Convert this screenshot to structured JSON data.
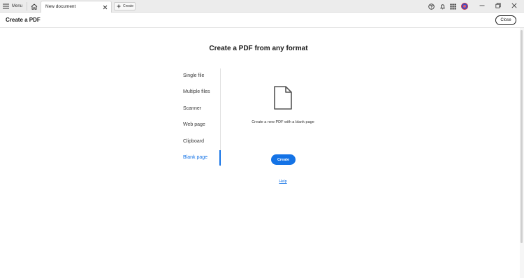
{
  "titlebar": {
    "menu_label": "Menu",
    "tab_title": "New document",
    "new_tab_label": "Create"
  },
  "toolbar": {
    "title": "Create a PDF",
    "close_label": "Close"
  },
  "main": {
    "heading": "Create a PDF from any format",
    "options": [
      {
        "label": "Single file",
        "selected": false
      },
      {
        "label": "Multiple files",
        "selected": false
      },
      {
        "label": "Scanner",
        "selected": false
      },
      {
        "label": "Web page",
        "selected": false
      },
      {
        "label": "Clipboard",
        "selected": false
      },
      {
        "label": "Blank page",
        "selected": true
      }
    ],
    "description": "Create a new PDF with a blank page",
    "create_label": "Create",
    "help_label": "Help"
  },
  "icons": {
    "menu": "hamburger-icon",
    "home": "home-icon",
    "tab_close": "close-icon",
    "new_tab": "plus-icon",
    "help": "help-icon",
    "notifications": "bell-icon",
    "apps": "apps-grid-icon",
    "file": "blank-document-icon"
  },
  "colors": {
    "accent": "#1473e6",
    "titlebar_bg": "#ececec",
    "avatar": "#3d4fc4"
  }
}
